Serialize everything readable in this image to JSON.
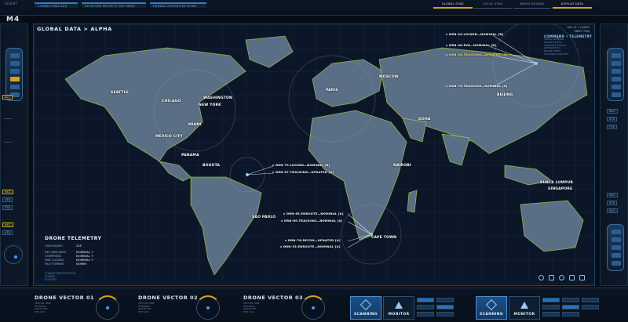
{
  "header": {
    "ident": "AGENT",
    "tabs": [
      "CONNECTING BAS",
      "SELECTED PRIORITY SETTINGS",
      "HANDLE PRIORITIES MODE"
    ],
    "sync": [
      "GLOBAL SYNC",
      "LOCAL SYNC",
      "MEDIA SOURCE",
      "DISPLAY DATA"
    ],
    "sync_active": "GLOBAL SYNC",
    "app_code": "M4"
  },
  "map": {
    "title": "GLOBAL DATA > ALPHA",
    "sub": [
      "SAT LV • LOADS",
      "ORBIT TRAJ"
    ],
    "cities": [
      "SEATTLE",
      "CHICAGO",
      "WASHINGTON",
      "NEW YORK",
      "MIAMI",
      "MEXICO CITY",
      "PANAMA",
      "BOGOTA",
      "SAO PAULO",
      "KUALA LUMPUR",
      "SINGAPORE",
      "DOHA",
      "NAIROBI",
      "CAPE TOWN",
      "PARIS",
      "MOSCOW",
      "BEIJING"
    ],
    "drones": [
      {
        "label": "DRN-45.LOCKED—NOMINAL [B]",
        "hl": false
      },
      {
        "label": "DRN-48.EVA—NOMINAL [B]",
        "hl": false
      },
      {
        "label": "DRN-26.TRACKING—UPDATED [A]",
        "hl": true
      },
      {
        "label": "DRN-78.TRACKING—NOMINAL [A]",
        "hl": false
      },
      {
        "label": "DRN-79.LOCKED—NOMINAL [B]",
        "hl": false
      },
      {
        "label": "DRN-67.TRACKING—UPDATED [A]",
        "hl": false
      },
      {
        "label": "DRN-65.ENROUTE—NOMINAL [A]",
        "hl": false
      },
      {
        "label": "DRN-69.TRACKING—NOMINAL [A]",
        "hl": false
      },
      {
        "label": "DRN-76.RECON—UPDATED [A]",
        "hl": false
      },
      {
        "label": "DRN-33.ENROUTE—NOMINAL [A]",
        "hl": false
      }
    ],
    "command": {
      "title": "COMMAND • TELEMETRY",
      "lines": [
        "SIGNAL NOMINAL",
        "UPLINK STATUS",
        "TRANSFER TARGET",
        "SATELLITE 4C",
        "DRONE FEEDS",
        "AVAILABLE UPDATES"
      ]
    }
  },
  "telemetry": {
    "title": "DRONE TELEMETRY",
    "checksum_label": "CHECKSUM:",
    "checksum_value": "22F",
    "rows": [
      {
        "k": "RECORD DATA",
        "v": "NOMINAL +"
      },
      {
        "k": "COMPRESS",
        "v": "NOMINAL +"
      },
      {
        "k": "VAR CLOSED",
        "v": "NOMINAL +"
      },
      {
        "k": "FILE FORMAT",
        "v": "NOMIN"
      }
    ],
    "footer": [
      "CONNECTION PROTOCOL",
      "SOURCE",
      "ROUTING"
    ]
  },
  "left_rail": {
    "keys": [
      "ACT",
      "NCC",
      "VTX",
      "FTX",
      "NCC",
      "VTX"
    ]
  },
  "right_rail": {
    "keys": [
      "NCC",
      "VTX",
      "FTX",
      "NCC",
      "VTX",
      "NCC"
    ]
  },
  "dock": {
    "vectors": [
      {
        "title": "DRONE VECTOR 01",
        "lines": [
          "VECTOR TIME",
          "IN RANGE",
          "ANGLE SET",
          "FILE LOG"
        ]
      },
      {
        "title": "DRONE VECTOR 02",
        "lines": [
          "VECTOR TIME",
          "IN RANGE",
          "ANGLE SET",
          "FILE LOG"
        ]
      },
      {
        "title": "DRONE VECTOR 03",
        "lines": [
          "VECTOR TIME",
          "IN RANGE",
          "ANGLE SET",
          "FILE LOG"
        ]
      }
    ],
    "controls": [
      "SCANNING",
      "MONITOR",
      "SCANNING",
      "MONITOR"
    ]
  },
  "colors": {
    "accent": "#2d7fd2",
    "amber": "#d9a21c",
    "land": "#5a6f86",
    "coast": "#b6e53a"
  }
}
